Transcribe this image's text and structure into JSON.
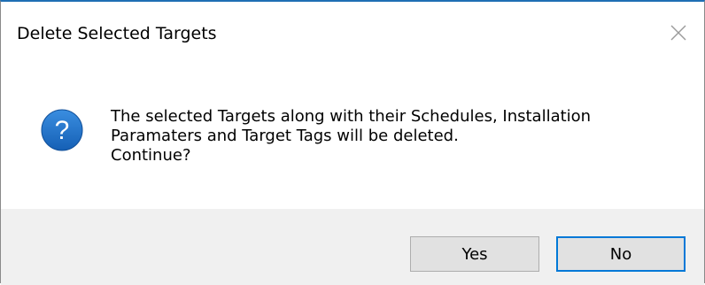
{
  "dialog": {
    "title": "Delete Selected Targets",
    "close_icon": "close-icon",
    "question_icon": "question-icon",
    "message_lines": [
      "The selected Targets along with their Schedules, Installation",
      "Paramaters and Target Tags will be deleted.",
      "Continue?"
    ],
    "buttons": {
      "yes_label": "Yes",
      "no_label": "No"
    },
    "colors": {
      "accent": "#0078d7",
      "icon_blue": "#1e6fc0",
      "footer_bg": "#f0f0f0"
    }
  }
}
